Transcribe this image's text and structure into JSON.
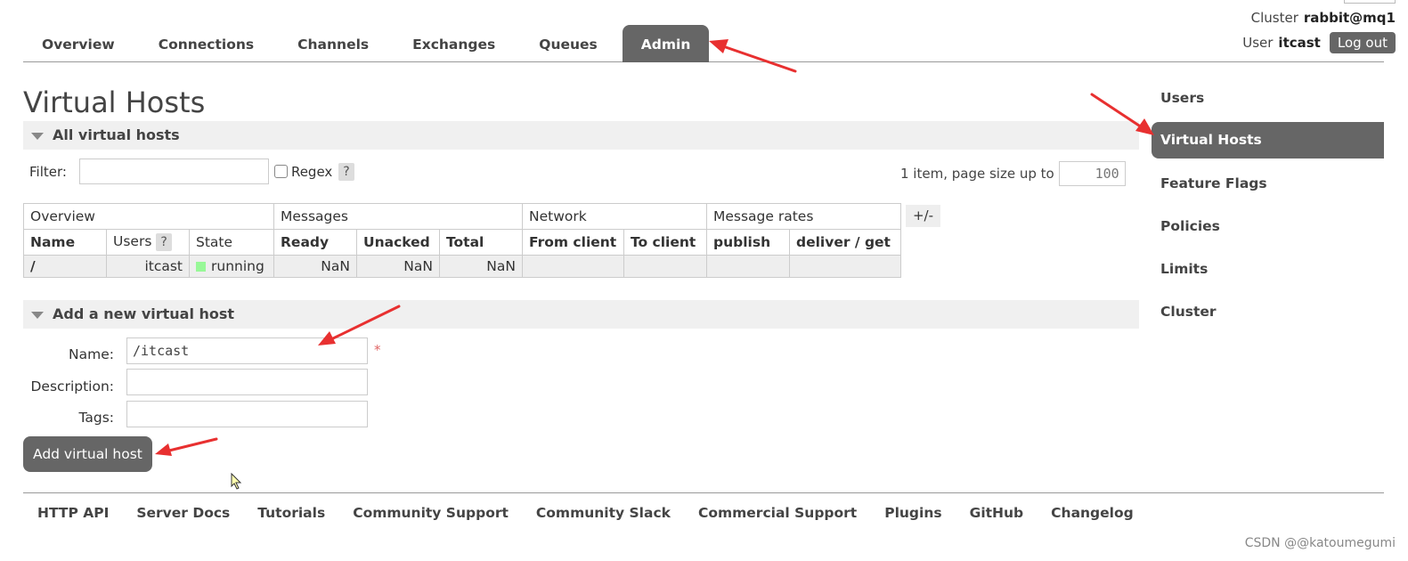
{
  "header": {
    "cluster_label": "Cluster",
    "cluster_name": "rabbit@mq1",
    "user_label": "User",
    "user_name": "itcast",
    "logout_label": "Log out"
  },
  "tabs": [
    {
      "label": "Overview"
    },
    {
      "label": "Connections"
    },
    {
      "label": "Channels"
    },
    {
      "label": "Exchanges"
    },
    {
      "label": "Queues"
    },
    {
      "label": "Admin",
      "active": true
    }
  ],
  "sidebar": {
    "items": [
      {
        "label": "Users"
      },
      {
        "label": "Virtual Hosts",
        "active": true
      },
      {
        "label": "Feature Flags"
      },
      {
        "label": "Policies"
      },
      {
        "label": "Limits"
      },
      {
        "label": "Cluster"
      }
    ]
  },
  "page": {
    "title": "Virtual Hosts"
  },
  "all_vhosts": {
    "section_title": "All virtual hosts",
    "filter_label": "Filter:",
    "filter_value": "",
    "regex_label": "Regex",
    "help_label": "?",
    "paging_text": "1 item, page size up to",
    "page_size": "100",
    "plus_minus": "+/-",
    "groups": [
      "Overview",
      "Messages",
      "Network",
      "Message rates"
    ],
    "columns": [
      "Name",
      "Users",
      "State",
      "Ready",
      "Unacked",
      "Total",
      "From client",
      "To client",
      "publish",
      "deliver / get"
    ],
    "users_help": "?",
    "rows": [
      {
        "name": "/",
        "users": "itcast",
        "state": "running",
        "ready": "NaN",
        "unacked": "NaN",
        "total": "NaN",
        "from_client": "",
        "to_client": "",
        "publish": "",
        "deliver_get": ""
      }
    ]
  },
  "add_vhost": {
    "section_title": "Add a new virtual host",
    "name_label": "Name:",
    "name_value": "/itcast",
    "required_mark": "*",
    "description_label": "Description:",
    "description_value": "",
    "tags_label": "Tags:",
    "tags_value": "",
    "submit_label": "Add virtual host"
  },
  "footer": {
    "links": [
      "HTTP API",
      "Server Docs",
      "Tutorials",
      "Community Support",
      "Community Slack",
      "Commercial Support",
      "Plugins",
      "GitHub",
      "Changelog"
    ]
  },
  "watermark": "CSDN @@katoumegumi",
  "colors": {
    "active_tab": "#666666",
    "annotation_arrow": "#e83030",
    "running_state": "#98f898"
  }
}
